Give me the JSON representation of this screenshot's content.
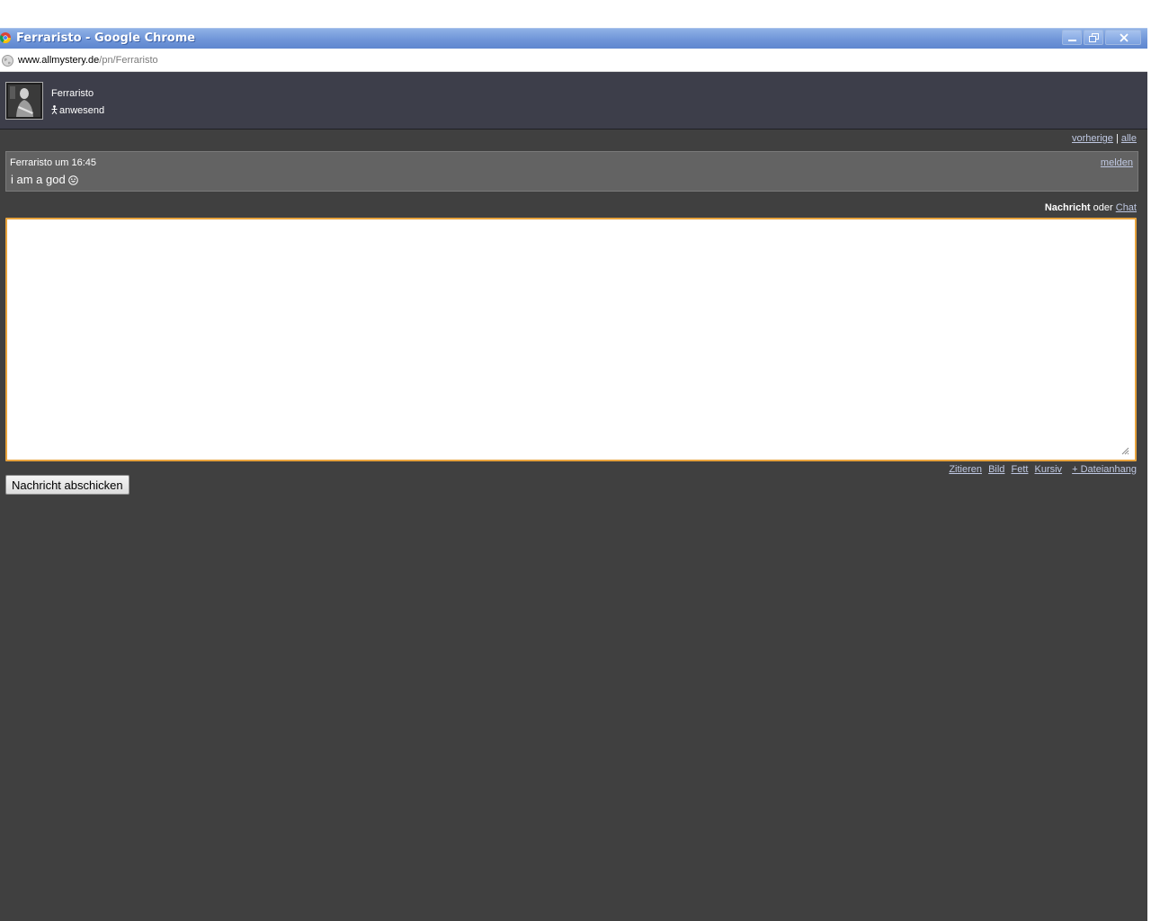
{
  "window": {
    "title": "Ferraristo - Google Chrome",
    "url_host": "www.allmystery.de",
    "url_path": "/pn/Ferraristo"
  },
  "profile": {
    "name": "Ferraristo",
    "status": "anwesend"
  },
  "navigation": {
    "previous": "vorherige",
    "separator": "|",
    "all": "alle"
  },
  "messages": [
    {
      "meta": "Ferraristo um 16:45",
      "text": "i am a god",
      "report": "melden"
    }
  ],
  "compose": {
    "mode_active": "Nachricht",
    "mode_or": "oder",
    "mode_alt": "Chat",
    "textarea_value": "",
    "format": {
      "quote": "Zitieren",
      "image": "Bild",
      "bold": "Fett",
      "italic": "Kursiv",
      "attachment": "+ Dateianhang"
    },
    "send_label": "Nachricht abschicken"
  },
  "colors": {
    "page_bg": "#404040",
    "header_bg": "#3d3e4a",
    "message_bg": "#636363",
    "focus_border": "#e8a33d",
    "link": "#bfc8e2"
  }
}
